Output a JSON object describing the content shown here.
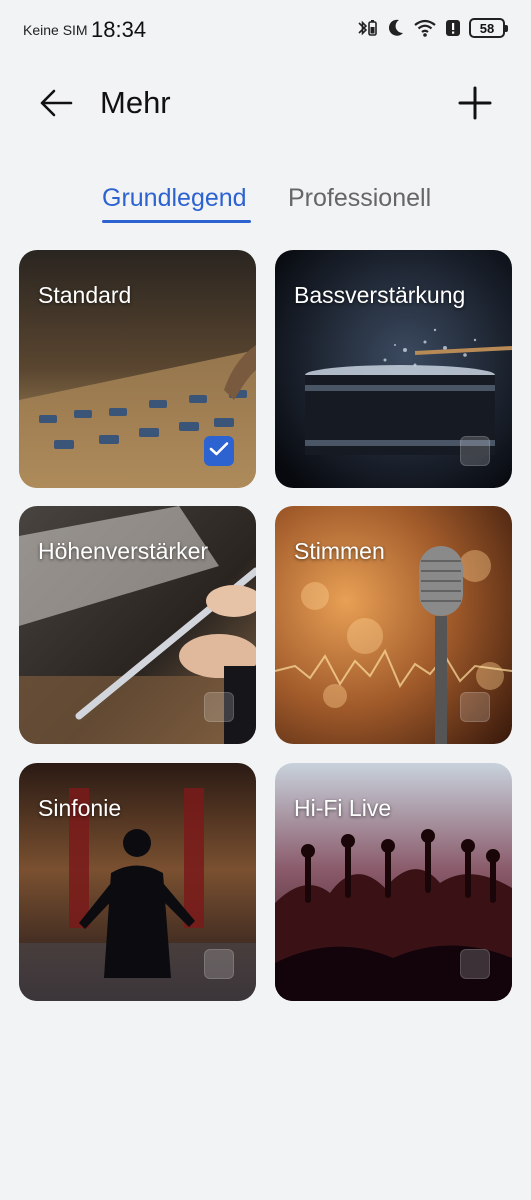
{
  "status_bar": {
    "carrier": "Keine SIM",
    "time": "18:34",
    "battery": "58"
  },
  "header": {
    "title": "Mehr"
  },
  "tabs": [
    {
      "label": "Grundlegend",
      "active": true
    },
    {
      "label": "Professionell",
      "active": false
    }
  ],
  "presets": [
    {
      "label": "Standard",
      "selected": true
    },
    {
      "label": "Bassverstärkung",
      "selected": false
    },
    {
      "label": "Höhenverstärker",
      "selected": false
    },
    {
      "label": "Stimmen",
      "selected": false
    },
    {
      "label": "Sinfonie",
      "selected": false
    },
    {
      "label": "Hi-Fi Live",
      "selected": false
    }
  ],
  "colors": {
    "accent": "#2d62d1",
    "background": "#f1f3f5"
  },
  "icons": {
    "back": "arrow-left-icon",
    "add": "plus-icon"
  }
}
